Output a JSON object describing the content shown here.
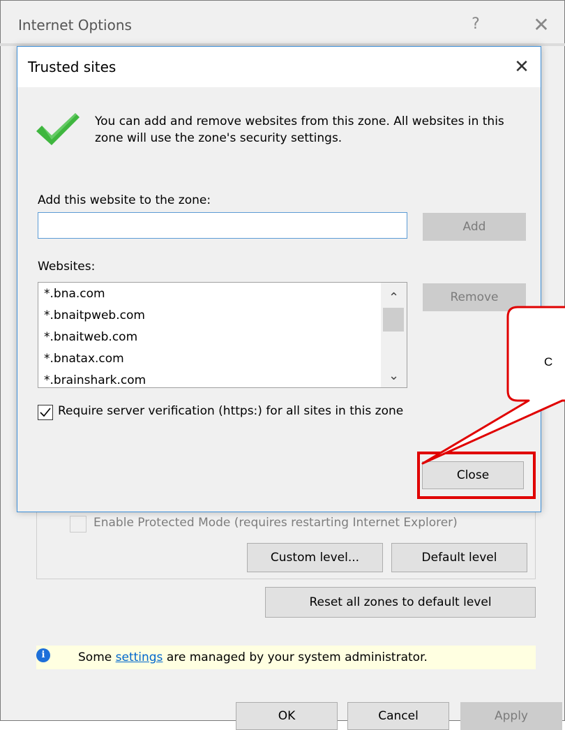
{
  "parent_window": {
    "title": "Internet Options",
    "help_glyph": "?",
    "close_glyph": "✕",
    "protected_mode_label": "Enable Protected Mode (requires restarting Internet Explorer)",
    "custom_level_label": "Custom level...",
    "default_level_label": "Default level",
    "reset_zones_label": "Reset all zones to default level",
    "info_bar": {
      "icon_glyph": "i",
      "text_before": "Some ",
      "link_text": "settings",
      "text_after": " are managed by your system administrator."
    },
    "ok_label": "OK",
    "cancel_label": "Cancel",
    "apply_label": "Apply"
  },
  "dialog": {
    "title": "Trusted sites",
    "close_glyph": "✕",
    "info_message": "You can add and remove websites from this zone. All websites in this zone will use the zone's security settings.",
    "add_label": "Add this website to the zone:",
    "website_input_value": "",
    "add_button_label": "Add",
    "websites_label": "Websites:",
    "websites": [
      "*.bna.com",
      "*.bnaitpweb.com",
      "*.bnaitweb.com",
      "*.bnatax.com",
      "*.brainshark.com"
    ],
    "remove_button_label": "Remove",
    "verify_label": "Require server verification (https:) for all sites in this zone",
    "verify_checked": true,
    "close_button_label": "Close"
  },
  "callout": {
    "text": "C"
  },
  "colors": {
    "accent_blue": "#3c8ed8",
    "highlight_red": "#e00000",
    "check_green": "#3fb63f",
    "info_bar_bg": "#ffffe1",
    "link_blue": "#0066cc"
  },
  "icons": {
    "check": "checkmark-icon",
    "info": "info-icon",
    "scroll_up": "chevron-up-icon",
    "scroll_down": "chevron-down-icon"
  }
}
